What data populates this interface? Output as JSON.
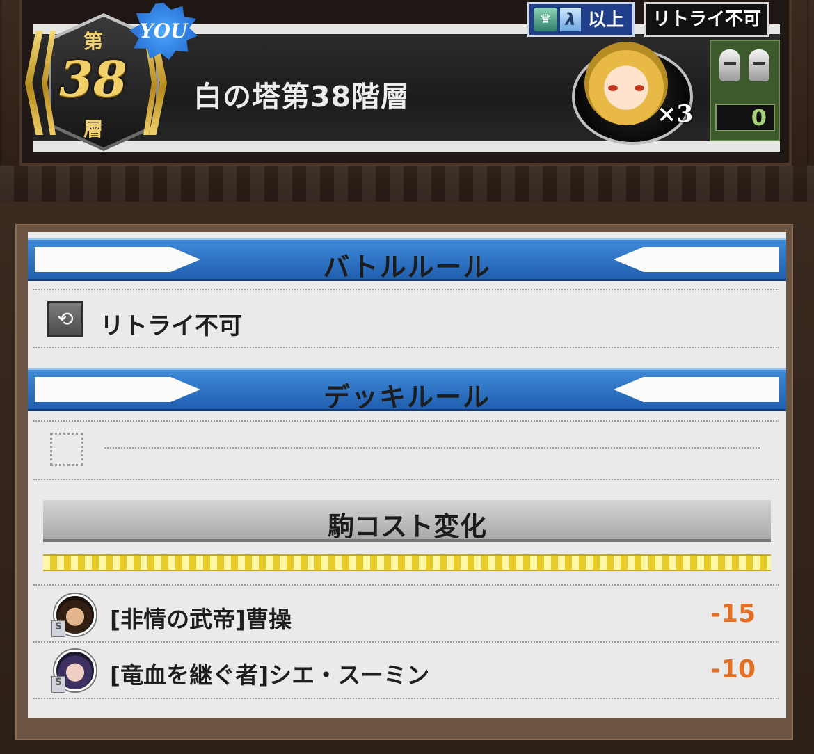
{
  "header": {
    "floor_prefix": "第",
    "floor_number": "38",
    "floor_suffix": "層",
    "you_badge": "YOU",
    "stage_title": "白の塔第38階層",
    "rank_requirement": {
      "rank_letter": "λ",
      "label": "以上"
    },
    "retry_badge": "リトライ不可",
    "reward_multiplier": "×3",
    "helmet_count": "0"
  },
  "battle_rules": {
    "title": "バトルルール",
    "items": [
      {
        "icon": "no-retry-icon",
        "label": "リトライ不可"
      }
    ]
  },
  "deck_rules": {
    "title": "デッキルール",
    "items": [
      {
        "icon": "empty-slot-icon",
        "label": ""
      }
    ]
  },
  "cost_change": {
    "title": "駒コスト変化",
    "units": [
      {
        "name": "[非情の武帝]曹操",
        "cost_delta": "-15",
        "badge": "S"
      },
      {
        "name": "[竜血を継ぐ者]シエ・スーミン",
        "cost_delta": "-10",
        "badge": "S"
      }
    ]
  },
  "colors": {
    "section_blue": "#2f74c6",
    "cost_orange": "#e26f23",
    "gold": "#f2d069"
  }
}
